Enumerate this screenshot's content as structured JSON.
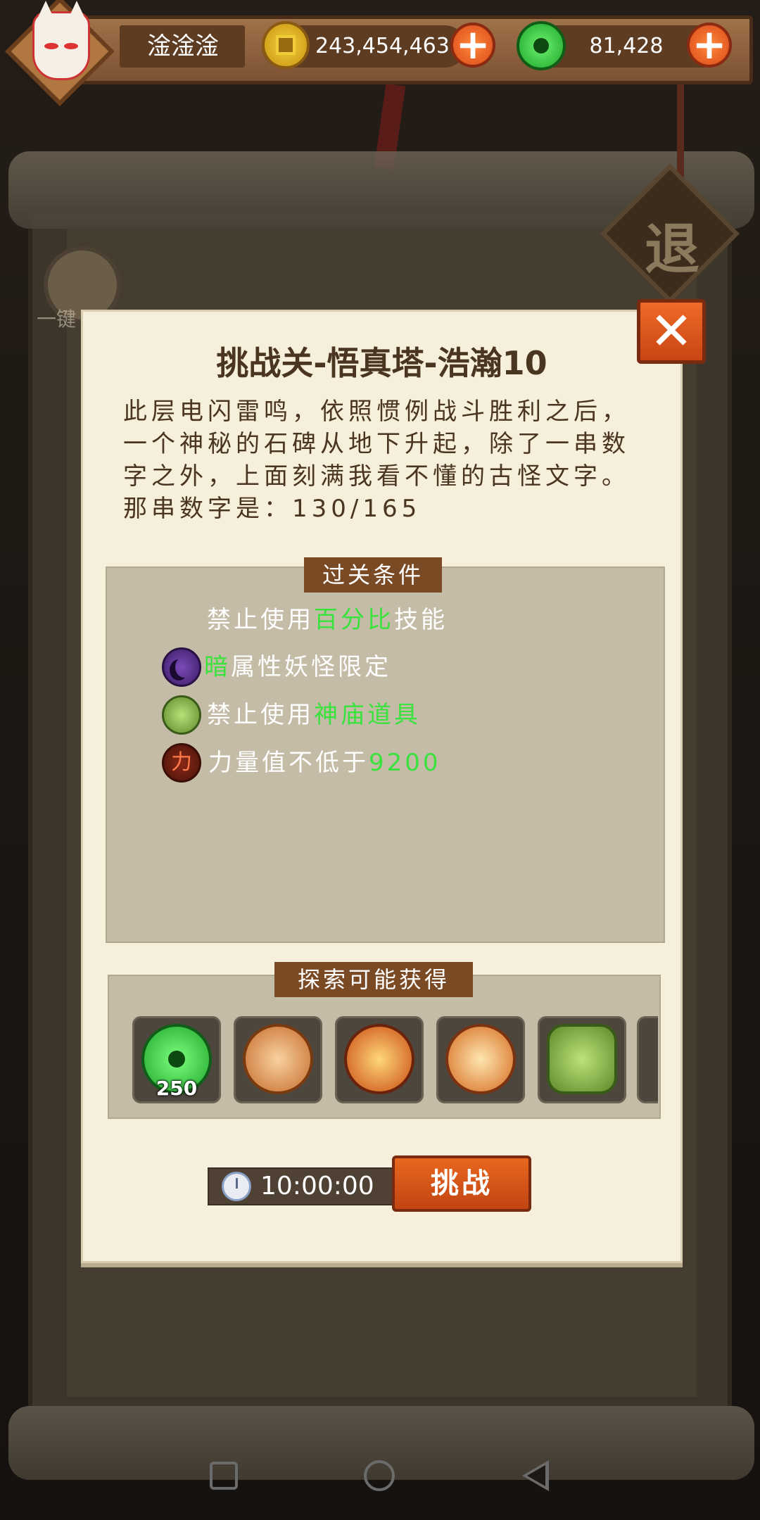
{
  "topbar": {
    "player_name": "淦淦淦",
    "coins": "243,454,463",
    "jade": "81,428",
    "plus_symbol": "+"
  },
  "background": {
    "exit_label": "退",
    "side_label": "一键"
  },
  "modal": {
    "title": "挑战关-悟真塔-浩瀚10",
    "description": "此层电闪雷鸣，依照惯例战斗胜利之后，一个神秘的石碑从地下升起，除了一串数字之外，上面刻满我看不懂的古怪文字。那串数字是：130/165",
    "close_symbol": "✕",
    "conditions_header": "过关条件",
    "conditions": [
      {
        "icon": "none",
        "prefix": "禁止使用",
        "highlight": "百分比",
        "suffix": "技能"
      },
      {
        "icon": "dark-moon-icon",
        "prefix": "",
        "highlight": "暗",
        "suffix": "属性妖怪限定"
      },
      {
        "icon": "temple-item-icon",
        "prefix": "禁止使用",
        "highlight": "神庙道具",
        "suffix": ""
      },
      {
        "icon": "power-icon",
        "prefix": "力量值不低于",
        "highlight": "9200",
        "suffix": ""
      }
    ],
    "rewards_header": "探索可能获得",
    "rewards": [
      {
        "icon": "jade-orb-icon",
        "count": "250"
      },
      {
        "icon": "swirl-orb-icon",
        "count": ""
      },
      {
        "icon": "fire-orb-icon",
        "count": ""
      },
      {
        "icon": "star-orb-icon",
        "count": ""
      },
      {
        "icon": "leaf-orb-icon",
        "count": ""
      }
    ],
    "timer": "10:00:00",
    "challenge_label": "挑战"
  },
  "colors": {
    "highlight_green": "#39e23c",
    "button_orange": "#e8671f",
    "panel_brown": "#7a4a25"
  }
}
